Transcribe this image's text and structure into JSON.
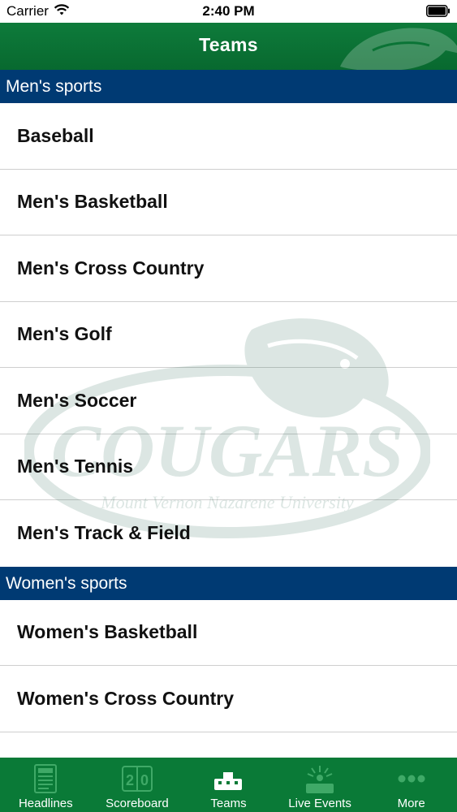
{
  "status_bar": {
    "carrier": "Carrier",
    "time": "2:40 PM",
    "wifi_icon": "wifi-icon",
    "battery_icon": "battery-icon"
  },
  "nav": {
    "title": "Teams"
  },
  "colors": {
    "brand_green": "#0a7a37",
    "section_blue": "#003a73",
    "row_text": "#111111",
    "divider": "#cfcfcf"
  },
  "sections": [
    {
      "title": "Men's sports",
      "items": [
        "Baseball",
        "Men's Basketball",
        "Men's Cross Country",
        "Men's Golf",
        "Men's Soccer",
        "Men's Tennis",
        "Men's Track & Field"
      ]
    },
    {
      "title": "Women's sports",
      "items": [
        "Women's Basketball",
        "Women's Cross Country"
      ]
    }
  ],
  "watermark": {
    "wordmark": "COUGARS",
    "subtitle": "Mount Vernon Nazarene University"
  },
  "tabs": [
    {
      "label": "Headlines",
      "icon": "headlines-icon"
    },
    {
      "label": "Scoreboard",
      "icon": "scoreboard-icon"
    },
    {
      "label": "Teams",
      "icon": "teams-icon",
      "selected": true
    },
    {
      "label": "Live Events",
      "icon": "live-events-icon"
    },
    {
      "label": "More",
      "icon": "more-icon"
    }
  ]
}
